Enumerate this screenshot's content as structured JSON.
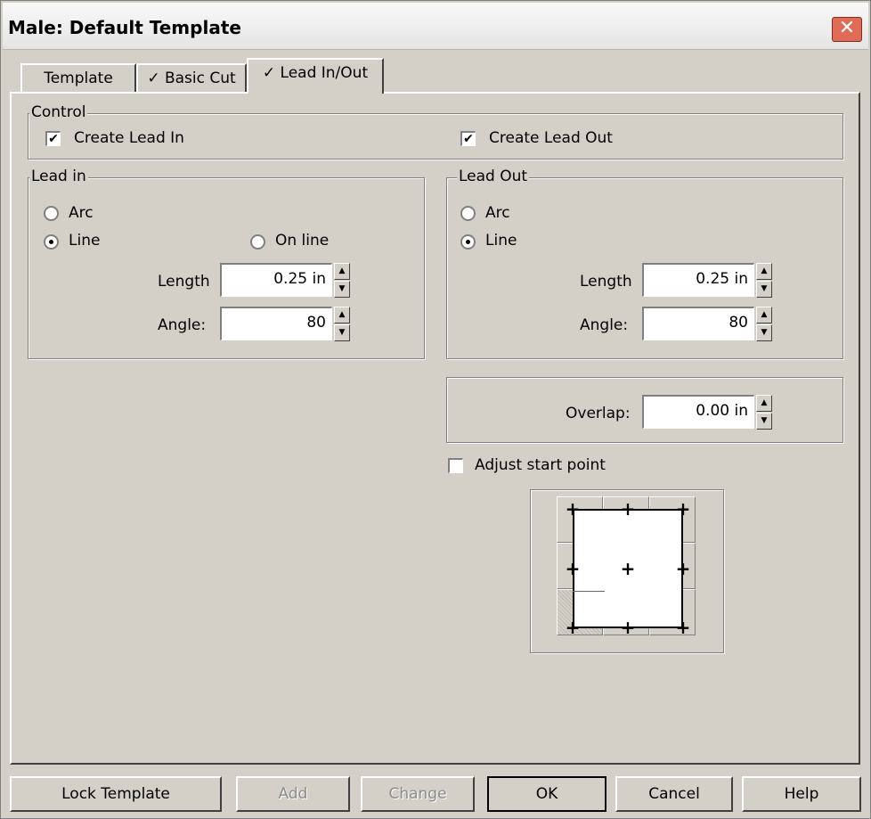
{
  "window": {
    "title": "Male: Default Template",
    "close_icon": "close-icon"
  },
  "tabs": [
    {
      "label": "Template"
    },
    {
      "label": "✓ Basic Cut"
    },
    {
      "label": "✓ Lead In/Out"
    }
  ],
  "control": {
    "label": "Control",
    "create_lead_in": {
      "label": "Create Lead In",
      "checked": true
    },
    "create_lead_out": {
      "label": "Create Lead Out",
      "checked": true
    }
  },
  "lead_in": {
    "label": "Lead in",
    "arc_label": "Arc",
    "line_label": "Line",
    "on_line_label": "On line",
    "length_label": "Length",
    "length_value": "0.25 in",
    "angle_label": "Angle:",
    "angle_value": "80"
  },
  "lead_out": {
    "label": "Lead Out",
    "arc_label": "Arc",
    "line_label": "Line",
    "length_label": "Length",
    "length_value": "0.25 in",
    "angle_label": "Angle:",
    "angle_value": "80"
  },
  "overlap": {
    "label": "Overlap:",
    "value": "0.00 in"
  },
  "adjust_start": {
    "label": "Adjust start point",
    "checked": false
  },
  "buttons": {
    "lock_template": "Lock Template",
    "add": "Add",
    "change": "Change",
    "ok": "OK",
    "cancel": "Cancel",
    "help": "Help"
  }
}
